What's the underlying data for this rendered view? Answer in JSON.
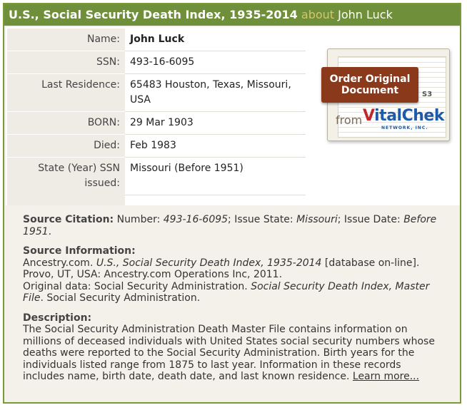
{
  "header": {
    "title": "U.S., Social Security Death Index, 1935-2014",
    "about": "about",
    "person": "John Luck"
  },
  "record": {
    "rows": [
      {
        "label": "Name:",
        "value": "John Luck"
      },
      {
        "label": "SSN:",
        "value": "493-16-6095"
      },
      {
        "label": "Last Residence:",
        "value_line1": "65483 Houston, Texas, Missouri,",
        "value_line2": "USA"
      },
      {
        "label": "BORN:",
        "value": "29 Mar 1903"
      },
      {
        "label": "Died:",
        "value": "Feb 1983"
      },
      {
        "label_line1": "State (Year) SSN",
        "label_line2": "issued:",
        "value": "Missouri (Before 1951)"
      }
    ]
  },
  "order_widget": {
    "line1": "Order Original",
    "line2": "Document",
    "from": "from",
    "brand_v": "V",
    "brand_rest": "italChek",
    "network": "NETWORK, INC.",
    "seal": "S3"
  },
  "citation": {
    "label": "Source Citation:",
    "t1": " Number: ",
    "number": "493-16-6095",
    "t2": "; Issue State: ",
    "state": "Missouri",
    "t3": "; Issue Date: ",
    "date": "Before 1951",
    "t4": "."
  },
  "source_info": {
    "heading": "Source Information:",
    "p1a": "Ancestry.com. ",
    "p1b": "U.S., Social Security Death Index, 1935-2014",
    "p1c": " [database on-line].",
    "p2": "Provo, UT, USA: Ancestry.com Operations Inc, 2011.",
    "p3a": "Original data: Social Security Administration. ",
    "p3b": "Social Security Death Index, Master File",
    "p3c": ". Social Security Administration."
  },
  "description": {
    "heading": "Description:",
    "text": "The Social Security Administration Death Master File contains information on millions of deceased individuals with United States social security numbers whose deaths were reported to the Social Security Administration. Birth years for the individuals listed range from 1875 to last year. Information in these records includes name, birth date, death date, and last known residence. ",
    "link": "Learn more..."
  }
}
